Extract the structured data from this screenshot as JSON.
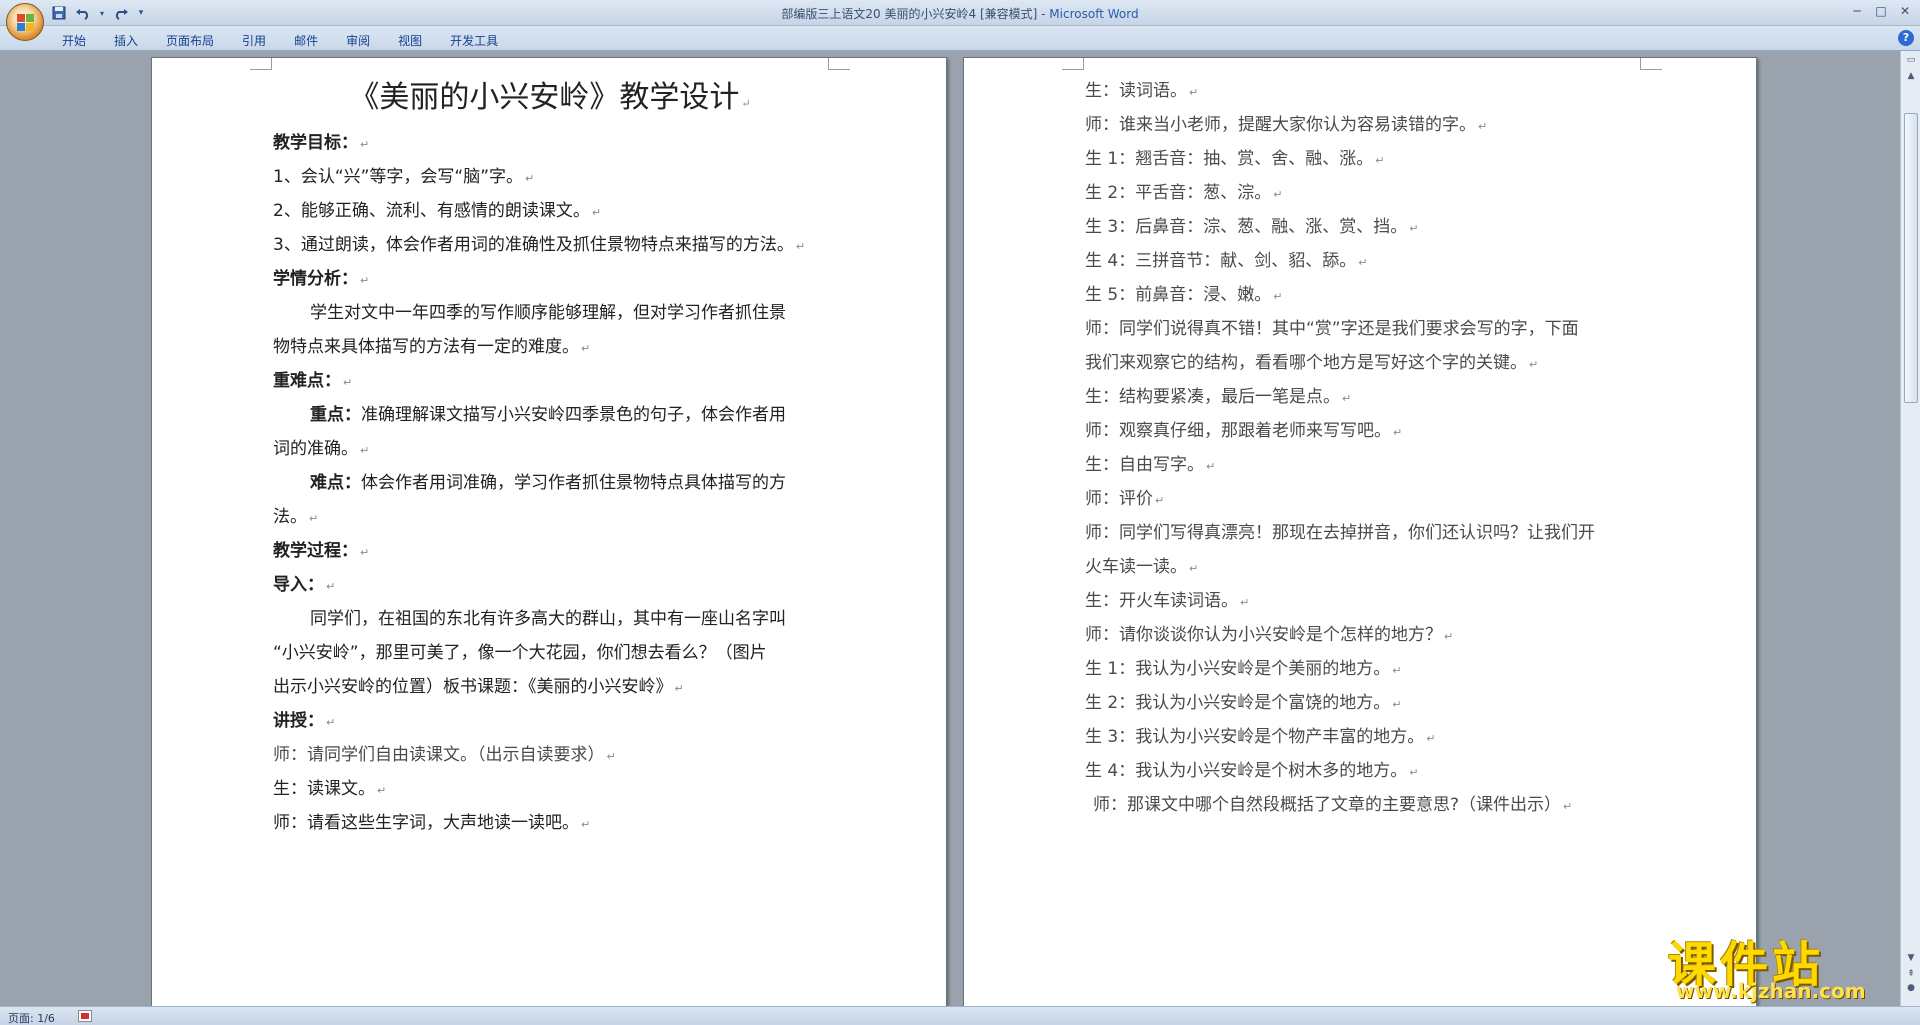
{
  "window": {
    "title_doc": "部编版三上语文20 美丽的小兴安岭4 [兼容模式]",
    "title_app": "Microsoft Word",
    "title_sep": " - ",
    "minimize": "─",
    "maximize": "□",
    "close": "✕"
  },
  "quick_access": {
    "save_icon": "floppy-save-icon",
    "undo_icon": "undo-icon",
    "redo_icon": "redo-icon",
    "customize_icon": "dropdown-icon"
  },
  "ribbon": {
    "tabs": [
      "开始",
      "插入",
      "页面布局",
      "引用",
      "邮件",
      "审阅",
      "视图",
      "开发工具"
    ],
    "help": "?"
  },
  "page1": {
    "title": "《美丽的小兴安岭》教学设计",
    "lines": [
      {
        "bold": "教学目标：",
        "text": ""
      },
      {
        "bold": "",
        "text": "1、会认“兴”等字，会写“脑”字。"
      },
      {
        "bold": "",
        "text": "2、能够正确、流利、有感情的朗读课文。"
      },
      {
        "bold": "",
        "text": "3、通过朗读，体会作者用词的准确性及抓住景物特点来描写的方法。"
      },
      {
        "bold": "学情分析：",
        "text": ""
      },
      {
        "bold": "",
        "text": "学生对文中一年四季的写作顺序能够理解，但对学习作者抓住景"
      },
      {
        "bold": "",
        "text": "物特点来具体描写的方法有一定的难度。"
      },
      {
        "bold": "重难点：",
        "text": ""
      },
      {
        "bold": "重点：",
        "text": "准确理解课文描写小兴安岭四季景色的句子，体会作者用"
      },
      {
        "bold": "",
        "text": "词的准确。"
      },
      {
        "bold": "难点：",
        "text": "体会作者用词准确，学习作者抓住景物特点具体描写的方"
      },
      {
        "bold": "",
        "text": "法。"
      },
      {
        "bold": "教学过程：",
        "text": ""
      },
      {
        "bold": "导入：",
        "text": ""
      },
      {
        "bold": "",
        "text": "同学们，在祖国的东北有许多高大的群山，其中有一座山名字叫"
      },
      {
        "bold": "",
        "text": "“小兴安岭”，那里可美了，像一个大花园，你们想去看么？（图片"
      },
      {
        "bold": "",
        "text": "出示小兴安岭的位置）板书课题：《美丽的小兴安岭》"
      },
      {
        "bold": "讲授：",
        "text": ""
      },
      {
        "bold": "",
        "text": "师：请同学们自由读课文。（出示自读要求）"
      },
      {
        "bold": "",
        "text": "生：读课文。"
      },
      {
        "bold": "",
        "text": "师：请看这些生字词，大声地读一读吧。"
      }
    ]
  },
  "page2": {
    "lines": [
      "生：读词语。",
      "师：谁来当小老师，提醒大家你认为容易读错的字。",
      "生 1：翘舌音：抽、赏、舍、融、涨。",
      "生 2：平舌音：葱、淙。",
      "生 3：后鼻音：淙、葱、融、涨、赏、挡。",
      "生 4：三拼音节：献、剑、貂、舔。",
      "生 5：前鼻音：浸、嫩。",
      "师：同学们说得真不错！其中“赏”字还是我们要求会写的字，下面",
      "我们来观察它的结构，看看哪个地方是写好这个字的关键。",
      "生：结构要紧凑，最后一笔是点。",
      "师：观察真仔细，那跟着老师来写写吧。",
      "生：自由写字。",
      "师：评价",
      "师：同学们写得真漂亮！那现在去掉拼音，你们还认识吗？让我们开",
      "火车读一读。",
      "生：开火车读词语。",
      "师：请你谈谈你认为小兴安岭是个怎样的地方？",
      "生 1：我认为小兴安岭是个美丽的地方。",
      "生 2：我认为小兴安岭是个富饶的地方。",
      "生 3：我认为小兴安岭是个物产丰富的地方。",
      "生 4：我认为小兴安岭是个树木多的地方。",
      "师：那课文中哪个自然段概括了文章的主要意思?（课件出示）"
    ]
  },
  "status": {
    "page_info": "页面: 1/6"
  },
  "watermark": {
    "title": "课件站",
    "url": "www.kjzhan.com"
  },
  "colors": {
    "accent": "#2b5aa8",
    "ribbon_tab_text": "#15428b",
    "watermark": "#ffd800"
  }
}
